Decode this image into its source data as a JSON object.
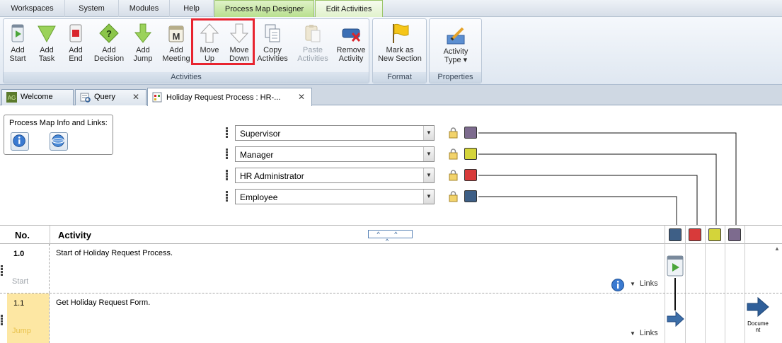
{
  "menubar": {
    "tabs": [
      {
        "label": "Workspaces"
      },
      {
        "label": "System"
      },
      {
        "label": "Modules"
      },
      {
        "label": "Help"
      }
    ],
    "context_tabs": [
      {
        "label": "Process Map Designer"
      },
      {
        "label": "Edit Activities"
      }
    ]
  },
  "ribbon": {
    "activities_group": {
      "label": "Activities",
      "buttons": [
        {
          "label1": "Add",
          "label2": "Start",
          "icon": "start-flag-icon"
        },
        {
          "label1": "Add",
          "label2": "Task",
          "icon": "triangle-down-icon"
        },
        {
          "label1": "Add",
          "label2": "End",
          "icon": "stop-icon"
        },
        {
          "label1": "Add",
          "label2": "Decision",
          "icon": "decision-diamond-icon"
        },
        {
          "label1": "Add",
          "label2": "Jump",
          "icon": "arrow-down-icon"
        },
        {
          "label1": "Add",
          "label2": "Meeting",
          "icon": "meeting-icon"
        },
        {
          "label1": "Move",
          "label2": "Up",
          "icon": "arrow-up-outline-icon"
        },
        {
          "label1": "Move",
          "label2": "Down",
          "icon": "arrow-down-outline-icon"
        },
        {
          "label1": "Copy",
          "label2": "Activities",
          "icon": "copy-icon"
        },
        {
          "label1": "Paste",
          "label2": "Activities",
          "icon": "paste-icon"
        },
        {
          "label1": "Remove",
          "label2": "Activity",
          "icon": "remove-icon"
        }
      ]
    },
    "format_group": {
      "label": "Format",
      "button": {
        "label1": "Mark as",
        "label2": "New Section",
        "icon": "flag-icon"
      }
    },
    "properties_group": {
      "label": "Properties",
      "button": {
        "label1": "Activity",
        "label2": "Type ▾",
        "icon": "edit-pencil-icon"
      }
    }
  },
  "doc_tabs": [
    {
      "label": "Welcome",
      "icon": "ag-logo-icon"
    },
    {
      "label": "Query",
      "icon": "query-icon"
    },
    {
      "label": "Holiday Request Process : HR-...",
      "icon": "process-map-icon"
    }
  ],
  "info_box": {
    "title": "Process Map Info and Links:"
  },
  "roles": [
    {
      "name": "Supervisor",
      "color": "#7d6b8e"
    },
    {
      "name": "Manager",
      "color": "#d4d43a"
    },
    {
      "name": "HR Administrator",
      "color": "#d83a3a"
    },
    {
      "name": "Employee",
      "color": "#3e5f86"
    }
  ],
  "grid": {
    "col_no": "No.",
    "col_activity": "Activity",
    "collapse_label": "^ ^ ^",
    "lane_colors": [
      "#3e5f86",
      "#d83a3a",
      "#d4d43a",
      "#7d6b8e"
    ]
  },
  "activities": [
    {
      "number": "1.0",
      "description": "Start of Holiday Request Process.",
      "type": "Start",
      "links": "Links"
    },
    {
      "number": "1.1",
      "description": "Get Holiday Request Form.",
      "type": "Jump",
      "links": "Links",
      "side_label": "Docume\nnt"
    }
  ]
}
